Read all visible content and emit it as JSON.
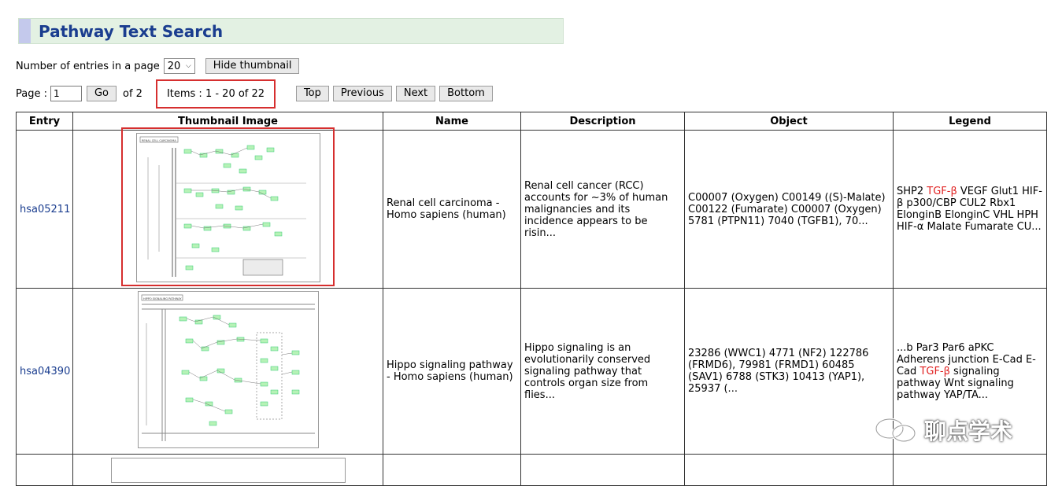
{
  "page_title": "Pathway Text Search",
  "controls": {
    "entries_label": "Number of entries in a page",
    "entries_value": "20",
    "hide_thumbnail_label": "Hide thumbnail",
    "page_label": "Page :",
    "page_value": "1",
    "go_label": "Go",
    "page_total": "of 2",
    "items_label": "Items : 1 - 20 of 22",
    "top_label": "Top",
    "previous_label": "Previous",
    "next_label": "Next",
    "bottom_label": "Bottom"
  },
  "table": {
    "headers": [
      "Entry",
      "Thumbnail Image",
      "Name",
      "Description",
      "Object",
      "Legend"
    ],
    "rows": [
      {
        "entry": "hsa05211",
        "thumbnail_title": "RENAL CELL CARCINOMA",
        "name": "Renal cell carcinoma - Homo sapiens (human)",
        "description": "Renal cell cancer (RCC) accounts for ~3% of human malignancies and its incidence appears to be risin...",
        "object": "C00007 (Oxygen) C00149 ((S)-Malate) C00122 (Fumarate) C00007 (Oxygen) 5781 (PTPN11) 7040 (TGFB1), 70...",
        "legend_before": "SHP2 ",
        "legend_highlight": "TGF-β",
        "legend_after": " VEGF Glut1 HIF-β p300/CBP CUL2 Rbx1 ElonginB ElonginC VHL HPH HIF-α Malate Fumarate CU..."
      },
      {
        "entry": "hsa04390",
        "thumbnail_title": "HIPPO SIGNALING PATHWAY",
        "name": "Hippo signaling pathway - Homo sapiens (human)",
        "description": "Hippo signaling is an evolutionarily conserved signaling pathway that controls organ size from flies...",
        "object": "23286 (WWC1) 4771 (NF2) 122786 (FRMD6), 79981 (FRMD1) 60485 (SAV1) 6788 (STK3) 10413 (YAP1), 25937 (...",
        "legend_before": "...b Par3 Par6 aPKC Adherens junction E-Cad E-Cad ",
        "legend_highlight": "TGF-β",
        "legend_after": " signaling pathway Wnt signaling pathway YAP/TA..."
      }
    ]
  },
  "watermark": "聊点学术",
  "colors": {
    "title_text": "#1a3d8f",
    "title_bg": "#e3f1e3",
    "highlight": "#d62f2f",
    "gene_box": "#b6f2b6"
  }
}
